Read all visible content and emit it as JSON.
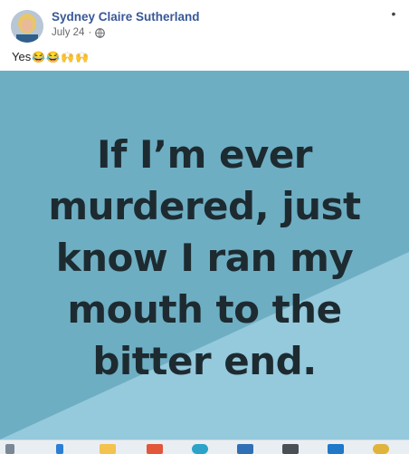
{
  "post": {
    "author": "Sydney Claire Sutherland",
    "date": "July 24",
    "dot": "·",
    "caption_text": "Yes",
    "caption_emojis": [
      "😂",
      "😂",
      "🙌",
      "🙌"
    ]
  },
  "image": {
    "lines": [
      "If I’m ever",
      "murdered, just",
      "know I ran my",
      "mouth to the",
      "bitter end."
    ]
  },
  "icons": {
    "audience": "globe-icon",
    "menu": "more-options-icon"
  },
  "colors": {
    "author_link": "#385898",
    "image_bg": "#6eaec3",
    "image_light": "#95c9dc",
    "quote_text": "#1d2b31"
  },
  "taskbar": {
    "items": [
      "start-icon",
      "files-icon",
      "office-icon",
      "edge-icon",
      "store-icon",
      "briefcase-icon",
      "mail-icon",
      "chrome-icon"
    ]
  }
}
